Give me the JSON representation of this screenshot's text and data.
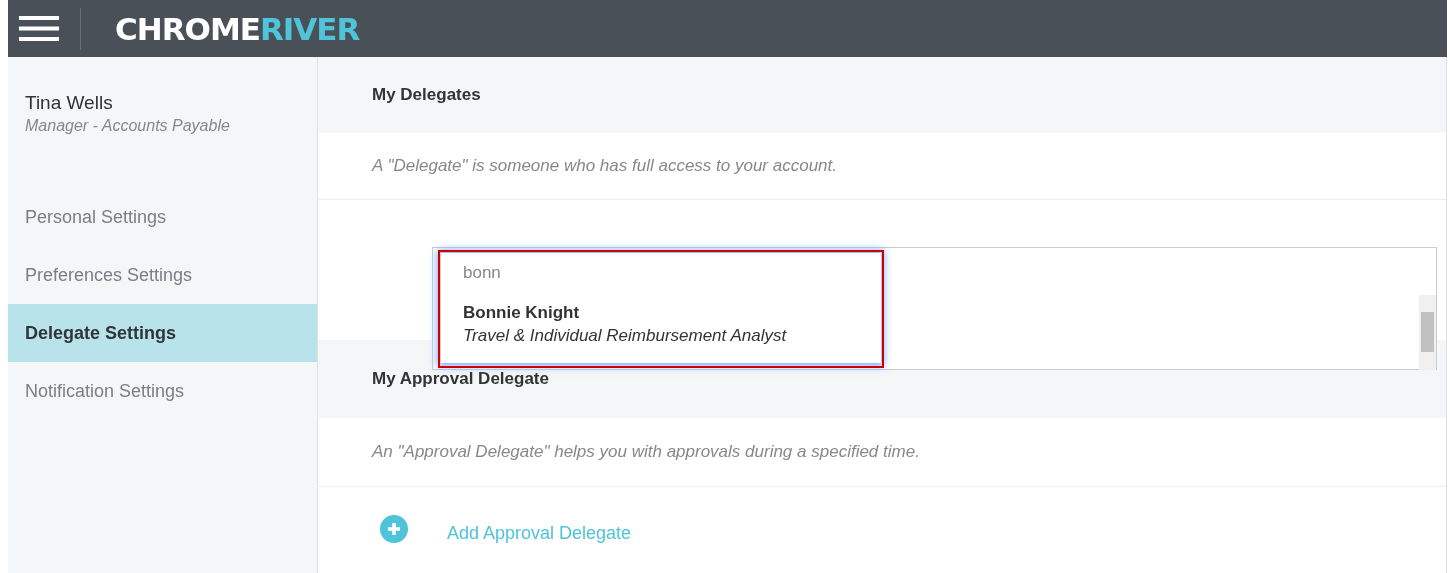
{
  "header": {
    "logo": {
      "text": "CHROME",
      "accent": "RIVER"
    }
  },
  "user": {
    "name": "Tina Wells",
    "role": "Manager - Accounts Payable"
  },
  "sidebar": {
    "items": [
      {
        "label": "Personal Settings",
        "selected": false
      },
      {
        "label": "Preferences Settings",
        "selected": false
      },
      {
        "label": "Delegate Settings",
        "selected": true
      },
      {
        "label": "Notification Settings",
        "selected": false
      }
    ]
  },
  "sections": [
    {
      "title": "My Delegates",
      "description": "A \"Delegate\" is someone who has full access to your account."
    },
    {
      "title": "My Approval Delegate",
      "description": "An \"Approval Delegate\" helps you with approvals during a specified time."
    }
  ],
  "delegate_search": {
    "value": "bonn",
    "suggestions": [
      {
        "name": "Bonnie Knight",
        "title": "Travel & Individual Reimbursement Analyst"
      }
    ]
  },
  "add_button": {
    "label": "Add Approval Delegate"
  }
}
